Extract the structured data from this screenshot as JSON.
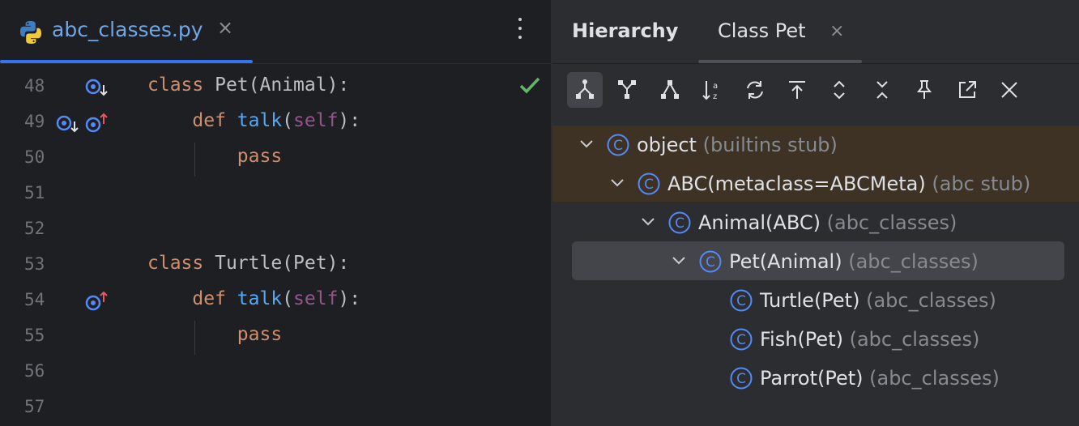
{
  "editor": {
    "tab": {
      "file_name": "abc_classes.py",
      "close": "×"
    },
    "lines": [
      {
        "num": "48",
        "code": [
          {
            "t": "class ",
            "c": "kw"
          },
          {
            "t": "Pet(Animal):",
            "c": ""
          }
        ]
      },
      {
        "num": "49",
        "code": [
          {
            "t": "    def ",
            "c": "kw"
          },
          {
            "t": "talk",
            "c": "fn"
          },
          {
            "t": "(",
            "c": ""
          },
          {
            "t": "self",
            "c": "self"
          },
          {
            "t": "):",
            "c": ""
          }
        ]
      },
      {
        "num": "50",
        "code": [
          {
            "t": "        pass",
            "c": "kw"
          }
        ]
      },
      {
        "num": "51",
        "code": []
      },
      {
        "num": "52",
        "code": []
      },
      {
        "num": "53",
        "code": [
          {
            "t": "class ",
            "c": "kw"
          },
          {
            "t": "Turtle(Pet):",
            "c": ""
          }
        ]
      },
      {
        "num": "54",
        "code": [
          {
            "t": "    def ",
            "c": "kw"
          },
          {
            "t": "talk",
            "c": "fn"
          },
          {
            "t": "(",
            "c": ""
          },
          {
            "t": "self",
            "c": "self"
          },
          {
            "t": "):",
            "c": ""
          }
        ]
      },
      {
        "num": "55",
        "code": [
          {
            "t": "        pass",
            "c": "kw"
          }
        ]
      },
      {
        "num": "56",
        "code": []
      },
      {
        "num": "57",
        "code": []
      }
    ]
  },
  "hierarchy": {
    "title": "Hierarchy",
    "tab": {
      "label": "Class Pet",
      "close": "×"
    },
    "toolbar": [
      {
        "icon": "subtypes-hierarchy-icon",
        "active": true
      },
      {
        "icon": "supertypes-hierarchy-icon",
        "active": false
      },
      {
        "icon": "class-hierarchy-icon",
        "active": false
      },
      {
        "icon": "sort-alphabetically-icon",
        "active": false
      },
      {
        "icon": "refresh-icon",
        "active": false
      },
      {
        "icon": "scroll-to-source-icon",
        "active": false
      },
      {
        "icon": "expand-all-icon",
        "active": false
      },
      {
        "icon": "collapse-all-icon",
        "active": false
      },
      {
        "icon": "pin-tab-icon",
        "active": false
      },
      {
        "icon": "export-icon",
        "active": false
      },
      {
        "icon": "close-icon",
        "active": false
      }
    ],
    "tree": [
      {
        "name": "object",
        "loc": "(builtins stub)",
        "depth": 0,
        "expanded": true
      },
      {
        "name": "ABC(metaclass=ABCMeta)",
        "loc": "(abc stub)",
        "depth": 1,
        "expanded": true
      },
      {
        "name": "Animal(ABC)",
        "loc": "(abc_classes)",
        "depth": 2,
        "expanded": true
      },
      {
        "name": "Pet(Animal)",
        "loc": "(abc_classes)",
        "depth": 3,
        "expanded": true,
        "selected": true
      },
      {
        "name": "Turtle(Pet)",
        "loc": "(abc_classes)",
        "depth": 4,
        "expanded": false
      },
      {
        "name": "Fish(Pet)",
        "loc": "(abc_classes)",
        "depth": 4,
        "expanded": false
      },
      {
        "name": "Parrot(Pet)",
        "loc": "(abc_classes)",
        "depth": 4,
        "expanded": false
      }
    ]
  },
  "colors": {
    "accent": "#3574f0",
    "class_icon": "#548af7",
    "check": "#5fb865",
    "override_arrow": "#e55765"
  }
}
